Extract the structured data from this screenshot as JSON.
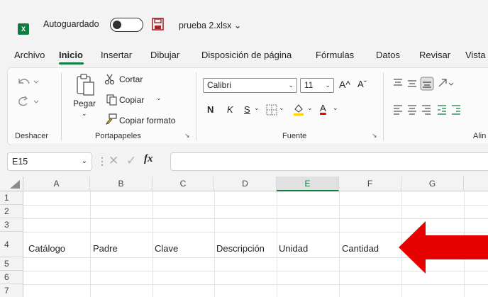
{
  "titlebar": {
    "app_icon_letter": "X",
    "autosave_label": "Autoguardado",
    "filename": "prueba 2.xlsx ⌄"
  },
  "menu": {
    "tabs": [
      "Archivo",
      "Inicio",
      "Insertar",
      "Dibujar",
      "Disposición de página",
      "Fórmulas",
      "Datos",
      "Revisar",
      "Vista"
    ],
    "active": "Inicio"
  },
  "ribbon": {
    "undo_group": "Deshacer",
    "clipboard": {
      "paste": "Pegar",
      "cut": "Cortar",
      "copy": "Copiar",
      "format_painter": "Copiar formato",
      "group": "Portapapeles"
    },
    "font": {
      "name": "Calibri",
      "size": "11",
      "grow": "A^",
      "shrink": "Aˇ",
      "bold": "N",
      "italic": "K",
      "underline": "S",
      "font_color": "A",
      "group": "Fuente"
    },
    "alignment_group": "Alin"
  },
  "formula_bar": {
    "name_box": "E15",
    "fx": "fx",
    "content": ""
  },
  "sheet": {
    "columns": [
      "A",
      "B",
      "C",
      "D",
      "E",
      "F",
      "G"
    ],
    "selected_column": "E",
    "rows": [
      "1",
      "2",
      "3",
      "4",
      "5",
      "6",
      "7"
    ],
    "row4": [
      "Catálogo",
      "Padre",
      "Clave",
      "Descripción",
      "Unidad",
      "Cantidad"
    ]
  },
  "colors": {
    "excel_green": "#107c41",
    "arrow_red": "#e60000"
  }
}
